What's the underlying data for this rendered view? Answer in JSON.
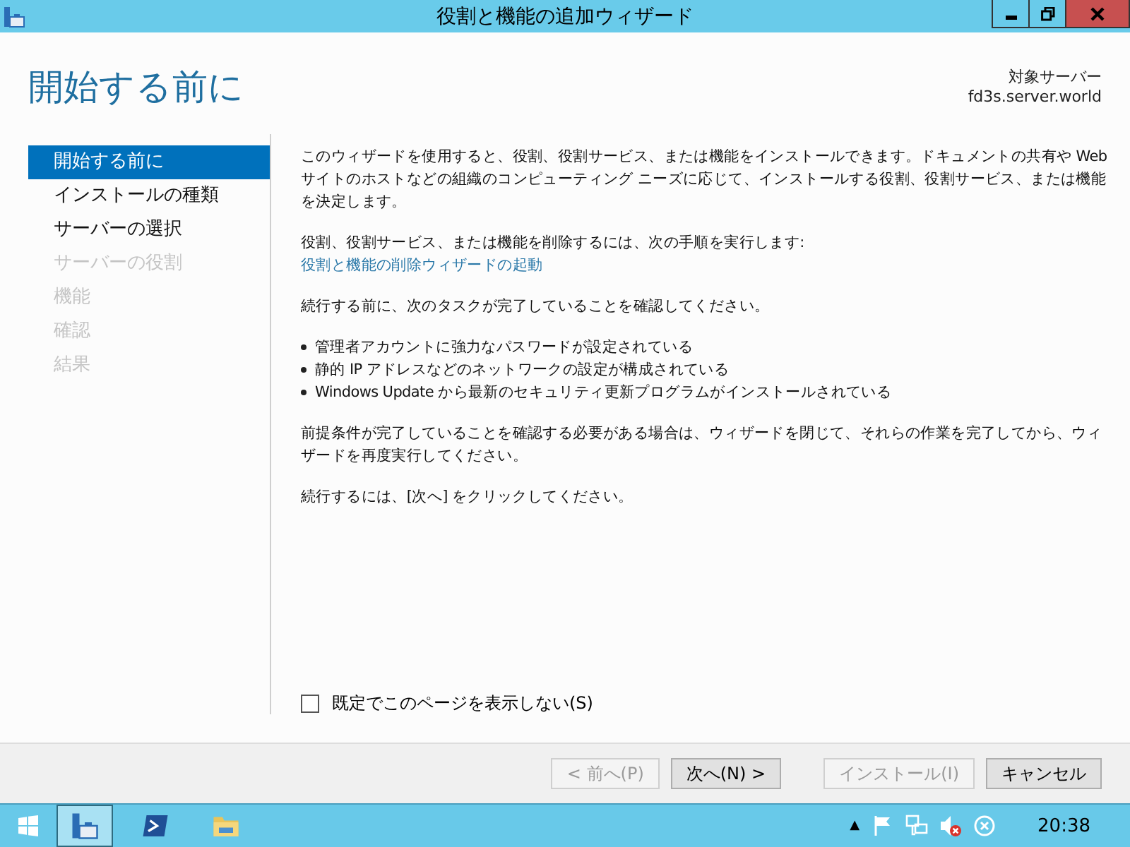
{
  "window": {
    "title": "役割と機能の追加ウィザード"
  },
  "header": {
    "heading": "開始する前に",
    "target_label": "対象サーバー",
    "target_server": "fd3s.server.world"
  },
  "sidebar": {
    "items": [
      {
        "label": "開始する前に",
        "selected": true,
        "disabled": false
      },
      {
        "label": "インストールの種類",
        "selected": false,
        "disabled": false
      },
      {
        "label": "サーバーの選択",
        "selected": false,
        "disabled": false
      },
      {
        "label": "サーバーの役割",
        "selected": false,
        "disabled": true
      },
      {
        "label": "機能",
        "selected": false,
        "disabled": true
      },
      {
        "label": "確認",
        "selected": false,
        "disabled": true
      },
      {
        "label": "結果",
        "selected": false,
        "disabled": true
      }
    ]
  },
  "content": {
    "blocks": [
      {
        "kind": "paragraph",
        "text": "このウィザードを使用すると、役割、役割サービス、または機能をインストールできます。ドキュメントの共有や Web サイトのホストなどの組織のコンピューティング ニーズに応じて、インストールする役割、役割サービス、または機能を決定します。"
      },
      {
        "kind": "paragraph",
        "text": "役割、役割サービス、または機能を削除するには、次の手順を実行します:",
        "link": "役割と機能の削除ウィザードの起動"
      },
      {
        "kind": "paragraph",
        "text": "続行する前に、次のタスクが完了していることを確認してください。"
      },
      {
        "kind": "bullets",
        "items": [
          "管理者アカウントに強力なパスワードが設定されている",
          "静的 IP アドレスなどのネットワークの設定が構成されている",
          "Windows Update から最新のセキュリティ更新プログラムがインストールされている"
        ]
      },
      {
        "kind": "paragraph",
        "text": "前提条件が完了していることを確認する必要がある場合は、ウィザードを閉じて、それらの作業を完了してから、ウィザードを再度実行してください。"
      },
      {
        "kind": "paragraph",
        "text": "続行するには、[次へ] をクリックしてください。"
      }
    ],
    "checkbox": {
      "label": "既定でこのページを表示しない(S)",
      "checked": false
    }
  },
  "buttons": [
    {
      "label": "< 前へ(P)",
      "disabled": true
    },
    {
      "label": "次へ(N) >",
      "disabled": false
    },
    {
      "label": "インストール(I)",
      "disabled": true
    },
    {
      "label": "キャンセル",
      "disabled": false
    }
  ],
  "taskbar": {
    "clock": "20:38",
    "tray_arrow": "▲"
  }
}
